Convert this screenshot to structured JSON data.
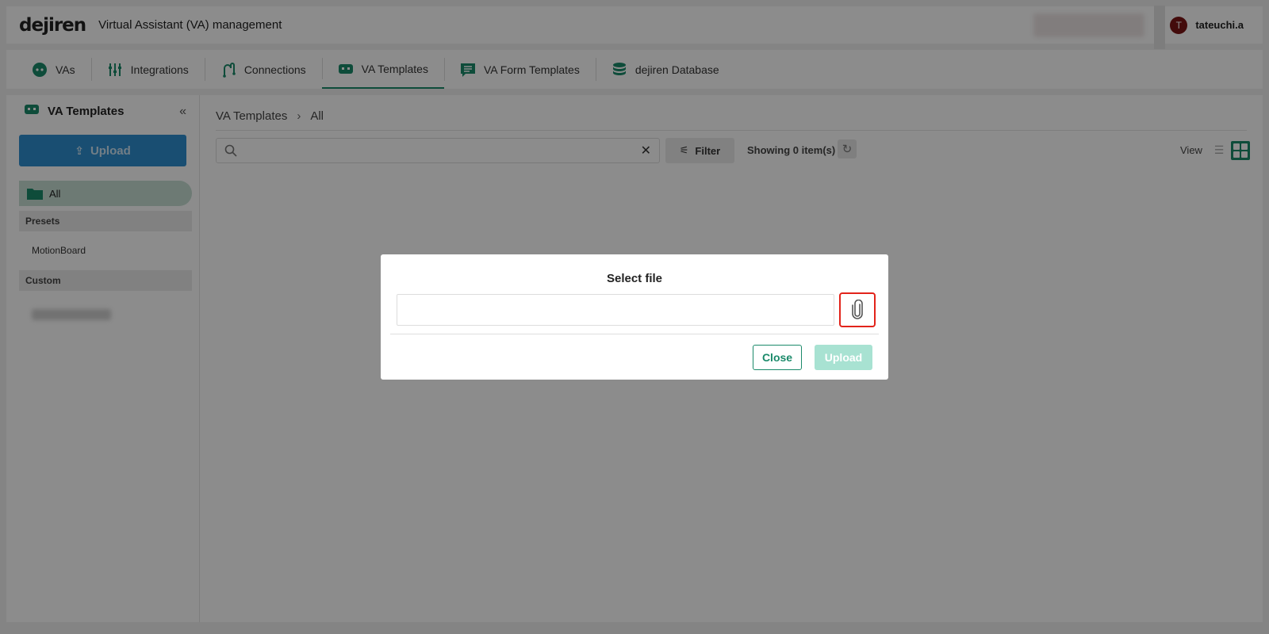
{
  "header": {
    "logo": "dejiren",
    "title": "Virtual Assistant (VA) management",
    "user_initial": "T",
    "username": "tateuchi.a"
  },
  "tabs": [
    {
      "label": "VAs",
      "icon": "robot-face-icon"
    },
    {
      "label": "Integrations",
      "icon": "sliders-icon"
    },
    {
      "label": "Connections",
      "icon": "connection-icon"
    },
    {
      "label": "VA Templates",
      "icon": "template-icon",
      "active": true
    },
    {
      "label": "VA Form Templates",
      "icon": "form-chat-icon"
    },
    {
      "label": "dejiren Database",
      "icon": "database-icon"
    }
  ],
  "sidebar": {
    "title": "VA Templates",
    "upload_label": "Upload",
    "all_label": "All",
    "presets_heading": "Presets",
    "presets_items": [
      "MotionBoard"
    ],
    "custom_heading": "Custom"
  },
  "main": {
    "breadcrumb": [
      "VA Templates",
      "All"
    ],
    "breadcrumb_sep": "›",
    "search_placeholder": "",
    "filter_label": "Filter",
    "showing_text": "Showing 0 item(s)",
    "view_label": "View"
  },
  "modal": {
    "title": "Select file",
    "file_value": "",
    "close_label": "Close",
    "upload_label": "Upload"
  },
  "colors": {
    "accent": "#1b8a6a",
    "upload_primary": "#2f8fd0",
    "highlight": "#e2231a"
  }
}
